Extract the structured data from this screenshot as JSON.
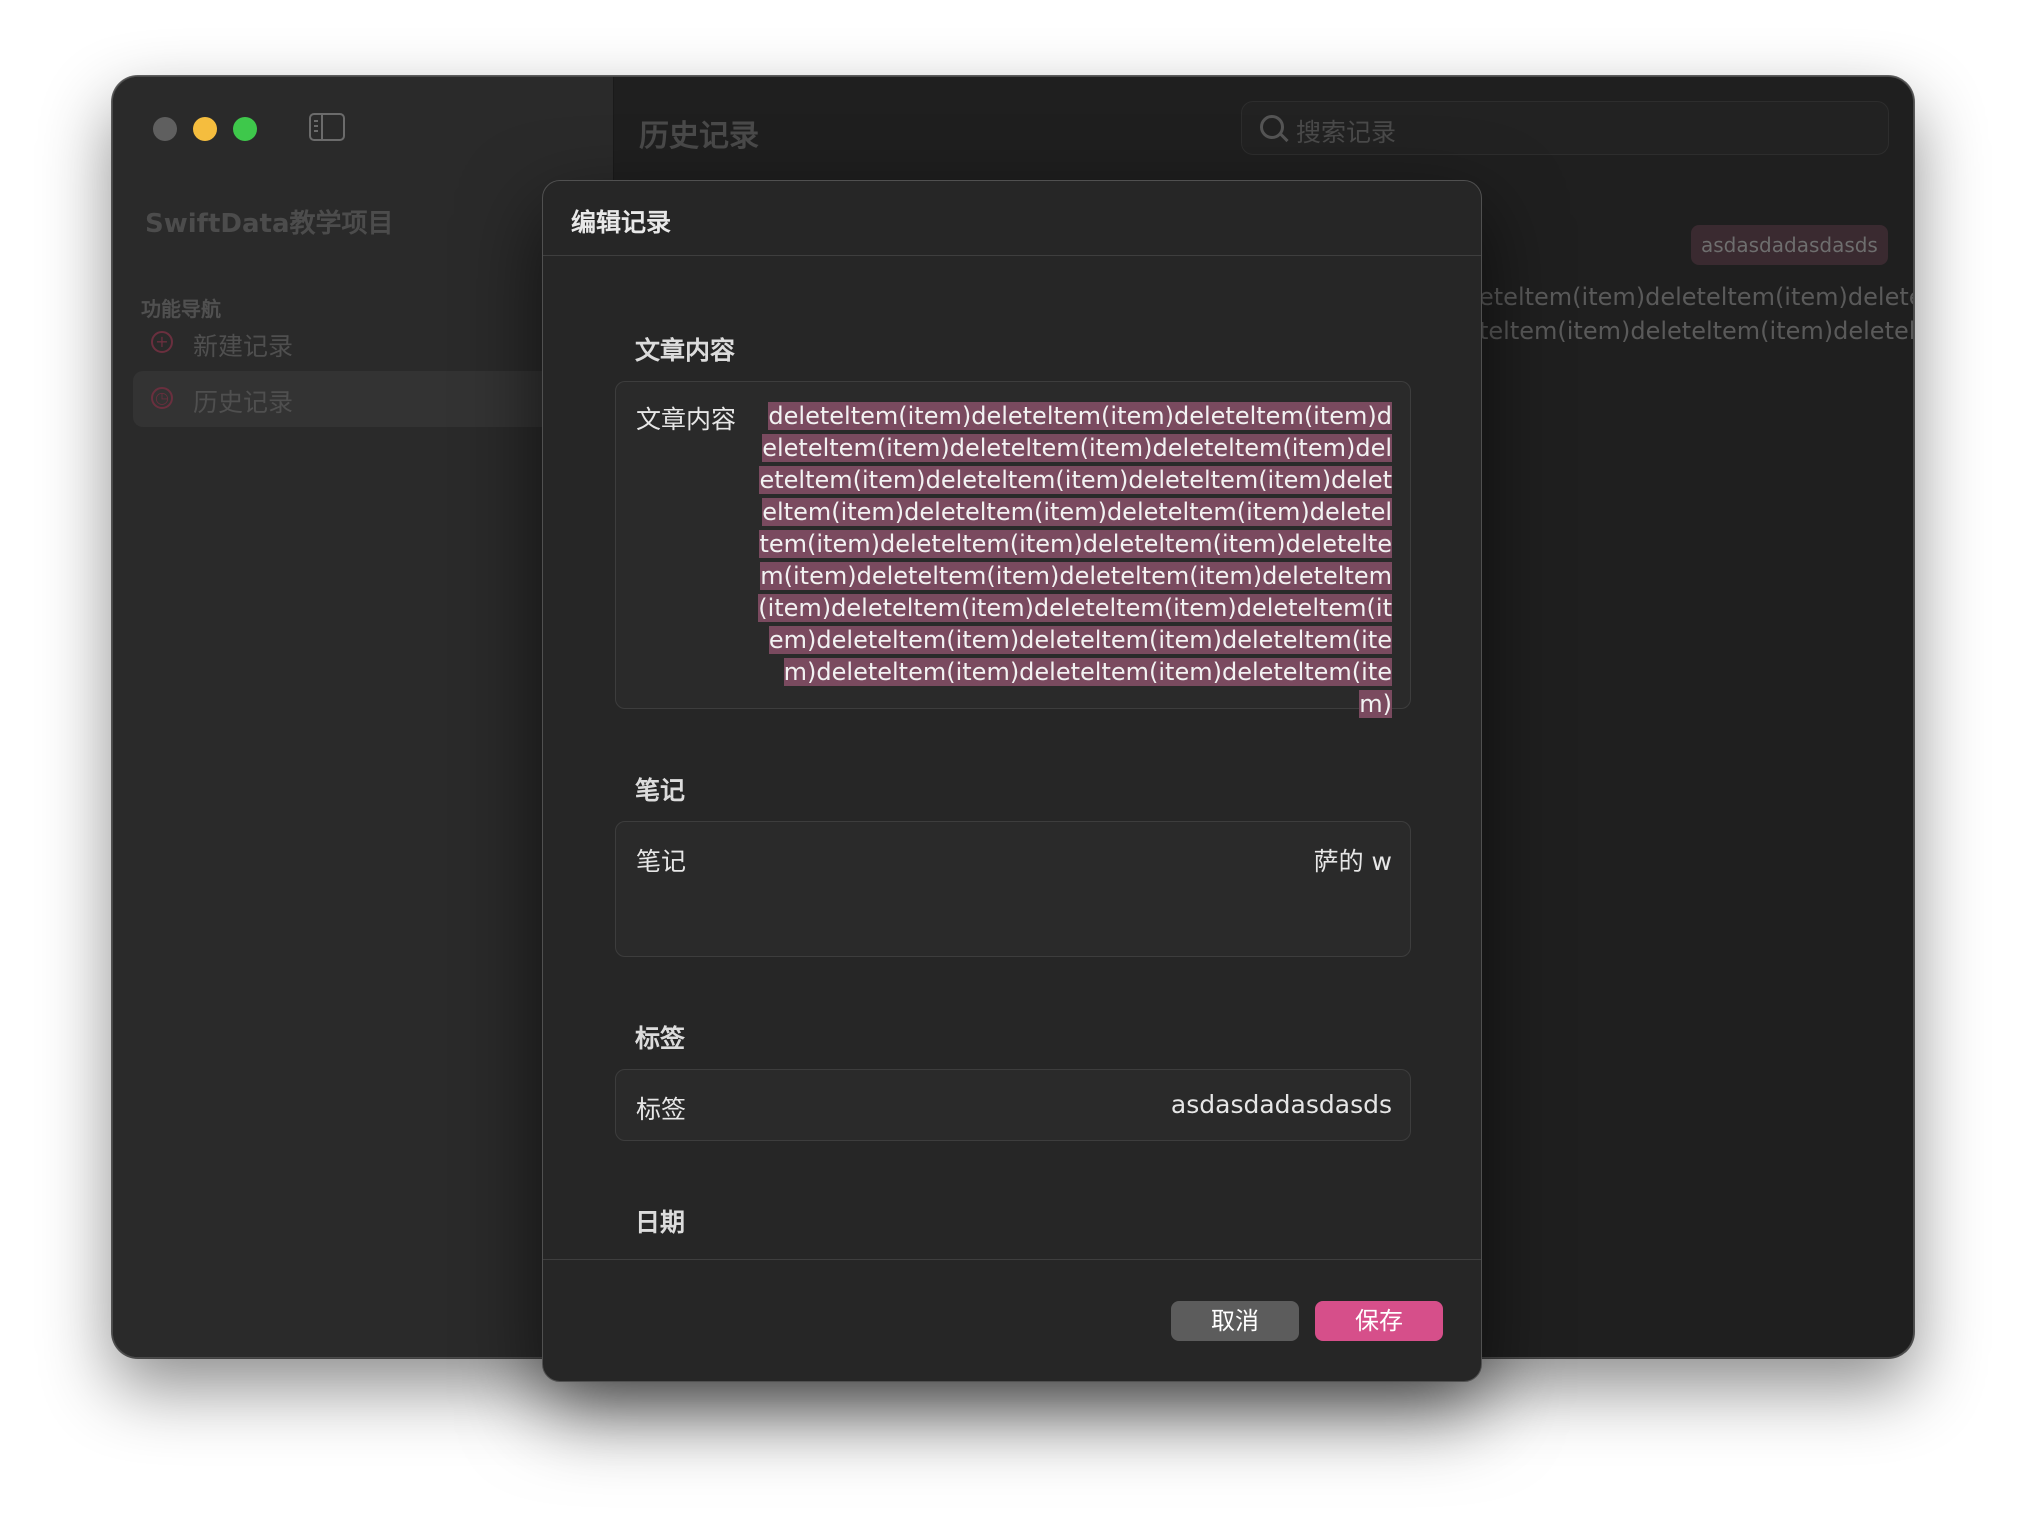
{
  "sidebar": {
    "project_title": "SwiftData教学项目",
    "nav_heading": "功能导航",
    "items": [
      {
        "label": "新建记录",
        "icon": "plus-circle-icon"
      },
      {
        "label": "历史记录",
        "icon": "clock-icon"
      }
    ]
  },
  "main": {
    "title": "历史记录",
    "search_placeholder": "搜索记录",
    "record_tag": "asdasdadasdasds",
    "record_preview_line1": "eteltem(item)deleteltem(item)deleteltem(item)d",
    "record_preview_line2": "teltem(item)deleteltem(item)deleteltem(item)d..."
  },
  "modal": {
    "title": "编辑记录",
    "content_section": "文章内容",
    "content_label": "文章内容",
    "content_value": "deleteltem(item)deleteltem(item)deleteltem(item)deleteltem(item)deleteltem(item)deleteltem(item)deleteltem(item)deleteltem(item)deleteltem(item)deleteltem(item)deleteltem(item)deleteltem(item)deleteltem(item)deleteltem(item)deleteltem(item)deleteltem(item)deleteltem(item)deleteltem(item)deleteltem(item)deleteltem(item)deleteltem(item)deleteltem(item)deleteltem(item)deleteltem(item)deleteltem(item)deleteltem(item)deleteltem(item)deleteltem(item)",
    "notes_section": "笔记",
    "notes_label": "笔记",
    "notes_value": "萨的 w",
    "tag_section": "标签",
    "tag_label": "标签",
    "tag_value": "asdasdadasdasds",
    "date_section": "日期",
    "cancel_label": "取消",
    "save_label": "保存"
  },
  "colors": {
    "accent": "#d64f8a",
    "selection": "#7a4a5f",
    "close": "#5f5f5f",
    "minimize": "#f5bd3e",
    "zoom": "#3ec84b"
  }
}
